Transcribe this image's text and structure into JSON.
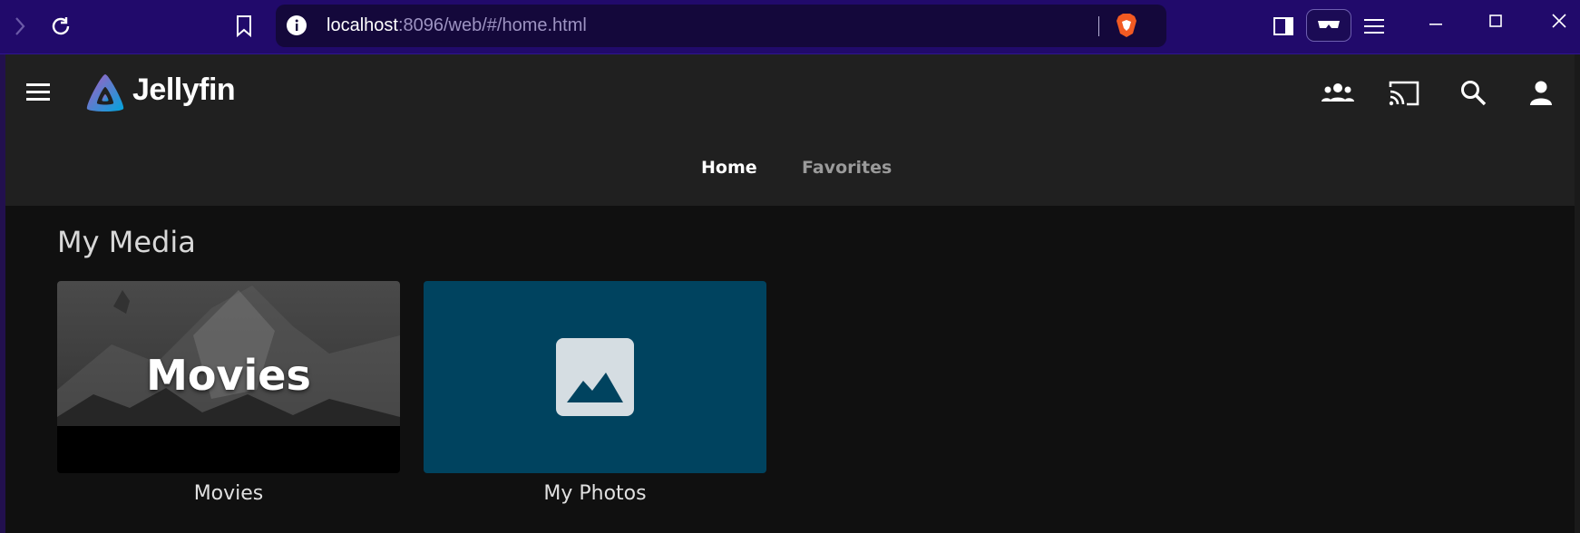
{
  "browser": {
    "url_host": "localhost",
    "url_path": ":8096/web/#/home.html",
    "chrome_color": "#210a6b"
  },
  "header": {
    "logo_text": "Jellyfin",
    "icons": [
      "menu-icon",
      "users-icon",
      "cast-icon",
      "search-icon",
      "user-icon"
    ]
  },
  "tabs": [
    {
      "label": "Home",
      "active": true
    },
    {
      "label": "Favorites",
      "active": false
    }
  ],
  "main": {
    "section_title": "My Media",
    "cards": [
      {
        "label": "Movies",
        "overlay": "Movies"
      },
      {
        "label": "My Photos",
        "color": "#00435f"
      }
    ]
  }
}
